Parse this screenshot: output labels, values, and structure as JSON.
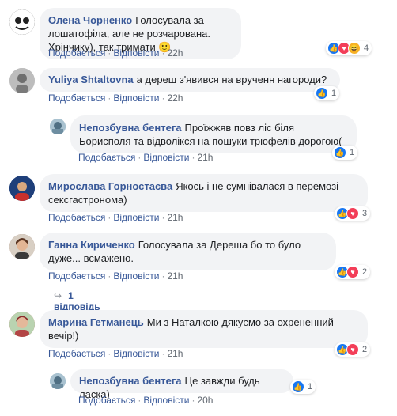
{
  "comments": [
    {
      "author": "Олена Чорненко",
      "text": "Голосувала за лошатофіла, але не розчарована. Хрінчику), так тримати",
      "emoji": "🙂",
      "like": "Подобається",
      "reply": "Відповісти",
      "time": "22h",
      "react_count": "4",
      "avatar_color": "#444444"
    },
    {
      "author": "Yuliya Shtaltovna",
      "text": "а дереш з'явився на врученн нагороди?",
      "like": "Подобається",
      "reply": "Відповісти",
      "time": "22h",
      "react_count": "1",
      "avatar_color": "#8a8a8a"
    },
    {
      "author": "Непозбувна бентега",
      "text": "Проїжжяв повз ліс біля Борисполя та відволікся на пошуки трюфелів дорогою(",
      "like": "Подобається",
      "reply": "Відповісти",
      "time": "21h",
      "react_count": "1",
      "avatar_color": "#5b7a8e"
    },
    {
      "author": "Мирослава Горностаєва",
      "text": "Якось і не сумнівалася в перемозі сексгастронома)",
      "like": "Подобається",
      "reply": "Відповісти",
      "time": "21h",
      "react_count": "3",
      "avatar_color": "#2b4c8c"
    },
    {
      "author": "Ганна Кириченко",
      "text": "Голосувала за Дереша бо то було дуже... всмажено.",
      "like": "Подобається",
      "reply": "Відповісти",
      "time": "21h",
      "react_count": "2",
      "avatar_color": "#a06a50"
    },
    {
      "author": "Марина Гетманець",
      "text": "Ми з Наталкою дякуємо за охрененний вечір!)",
      "like": "Подобається",
      "reply": "Відповісти",
      "time": "21h",
      "react_count": "2",
      "avatar_color": "#b04a4a"
    },
    {
      "author": "Непозбувна бентега",
      "text": "Це завжди будь ласка)",
      "like": "Подобається",
      "reply": "Відповісти",
      "time": "20h",
      "react_count": "1",
      "avatar_color": "#5b7a8e"
    }
  ],
  "replies_link": "1 відповідь",
  "colors": {
    "link": "#385898",
    "bubble": "#f2f3f5",
    "meta": "#90949c"
  }
}
